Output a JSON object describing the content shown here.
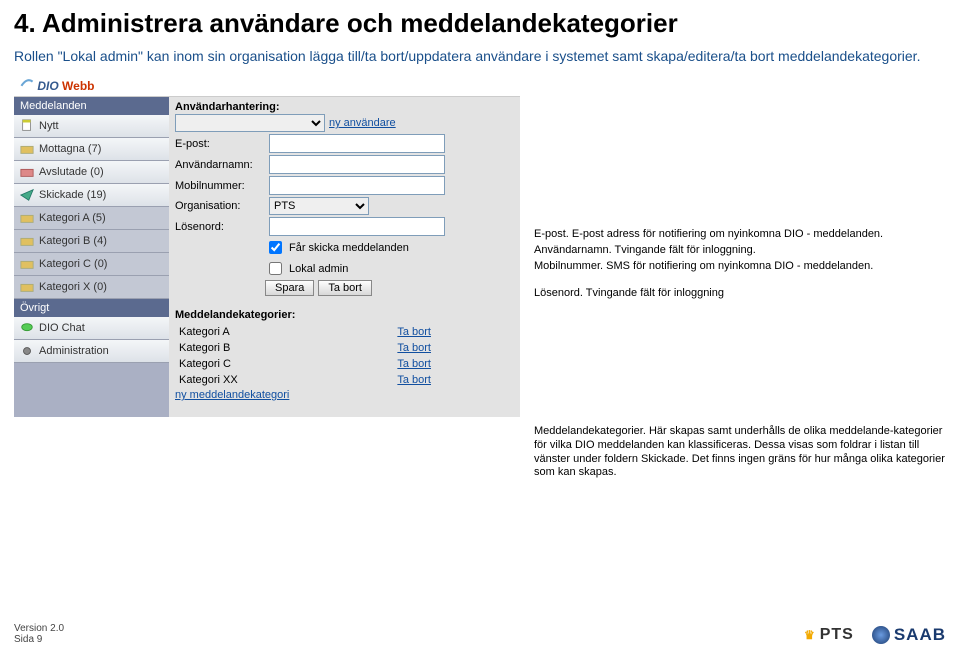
{
  "heading": "4. Administrera användare och meddelandekategorier",
  "intro": "Rollen \"Lokal admin\" kan inom sin organisation lägga till/ta bort/uppdatera användare i systemet samt skapa/editera/ta bort meddelandekategorier.",
  "logo": {
    "a": "DIO",
    "b": "Webb"
  },
  "sidebar": {
    "sec1": "Meddelanden",
    "items": [
      {
        "label": "Nytt"
      },
      {
        "label": "Mottagna (7)"
      },
      {
        "label": "Avslutade (0)"
      },
      {
        "label": "Skickade (19)"
      }
    ],
    "cats": [
      {
        "label": "Kategori A (5)"
      },
      {
        "label": "Kategori B (4)"
      },
      {
        "label": "Kategori C (0)"
      },
      {
        "label": "Kategori X (0)"
      }
    ],
    "sec2": "Övrigt",
    "extra": [
      {
        "label": "DIO Chat"
      },
      {
        "label": "Administration"
      }
    ]
  },
  "main": {
    "title": "Användarhantering:",
    "newuser": "ny användare",
    "fields": {
      "epost": "E-post:",
      "anvandarnamn": "Användarnamn:",
      "mobil": "Mobilnummer:",
      "org": "Organisation:",
      "org_value": "PTS",
      "losen": "Lösenord:"
    },
    "chk1": "Får skicka meddelanden",
    "chk2": "Lokal admin",
    "save": "Spara",
    "del": "Ta bort",
    "cat_title": "Meddelandekategorier:",
    "cats": [
      {
        "name": "Kategori A",
        "action": "Ta bort"
      },
      {
        "name": "Kategori B",
        "action": "Ta bort"
      },
      {
        "name": "Kategori C",
        "action": "Ta bort"
      },
      {
        "name": "Kategori XX",
        "action": "Ta bort"
      }
    ],
    "newcat": "ny meddelandekategori"
  },
  "ann": {
    "l1": "E-post. E-post adress för notifiering om nyinkomna DIO - meddelanden.",
    "l2": "Användarnamn. Tvingande fält för inloggning.",
    "l3": "Mobilnummer. SMS för notifiering om nyinkomna DIO - meddelanden.",
    "l4": "Lösenord. Tvingande fält för inloggning",
    "l5": "Meddelandekategorier. Här skapas samt underhålls de olika meddelande-kategorier för vilka DIO meddelanden kan klassificeras. Dessa visas som foldrar i listan till vänster under foldern Skickade. Det finns ingen gräns för hur många olika kategorier som kan skapas."
  },
  "footer": {
    "version": "Version 2.0",
    "sida": "Sida 9",
    "pts": "PTS",
    "saab": "SAAB"
  }
}
